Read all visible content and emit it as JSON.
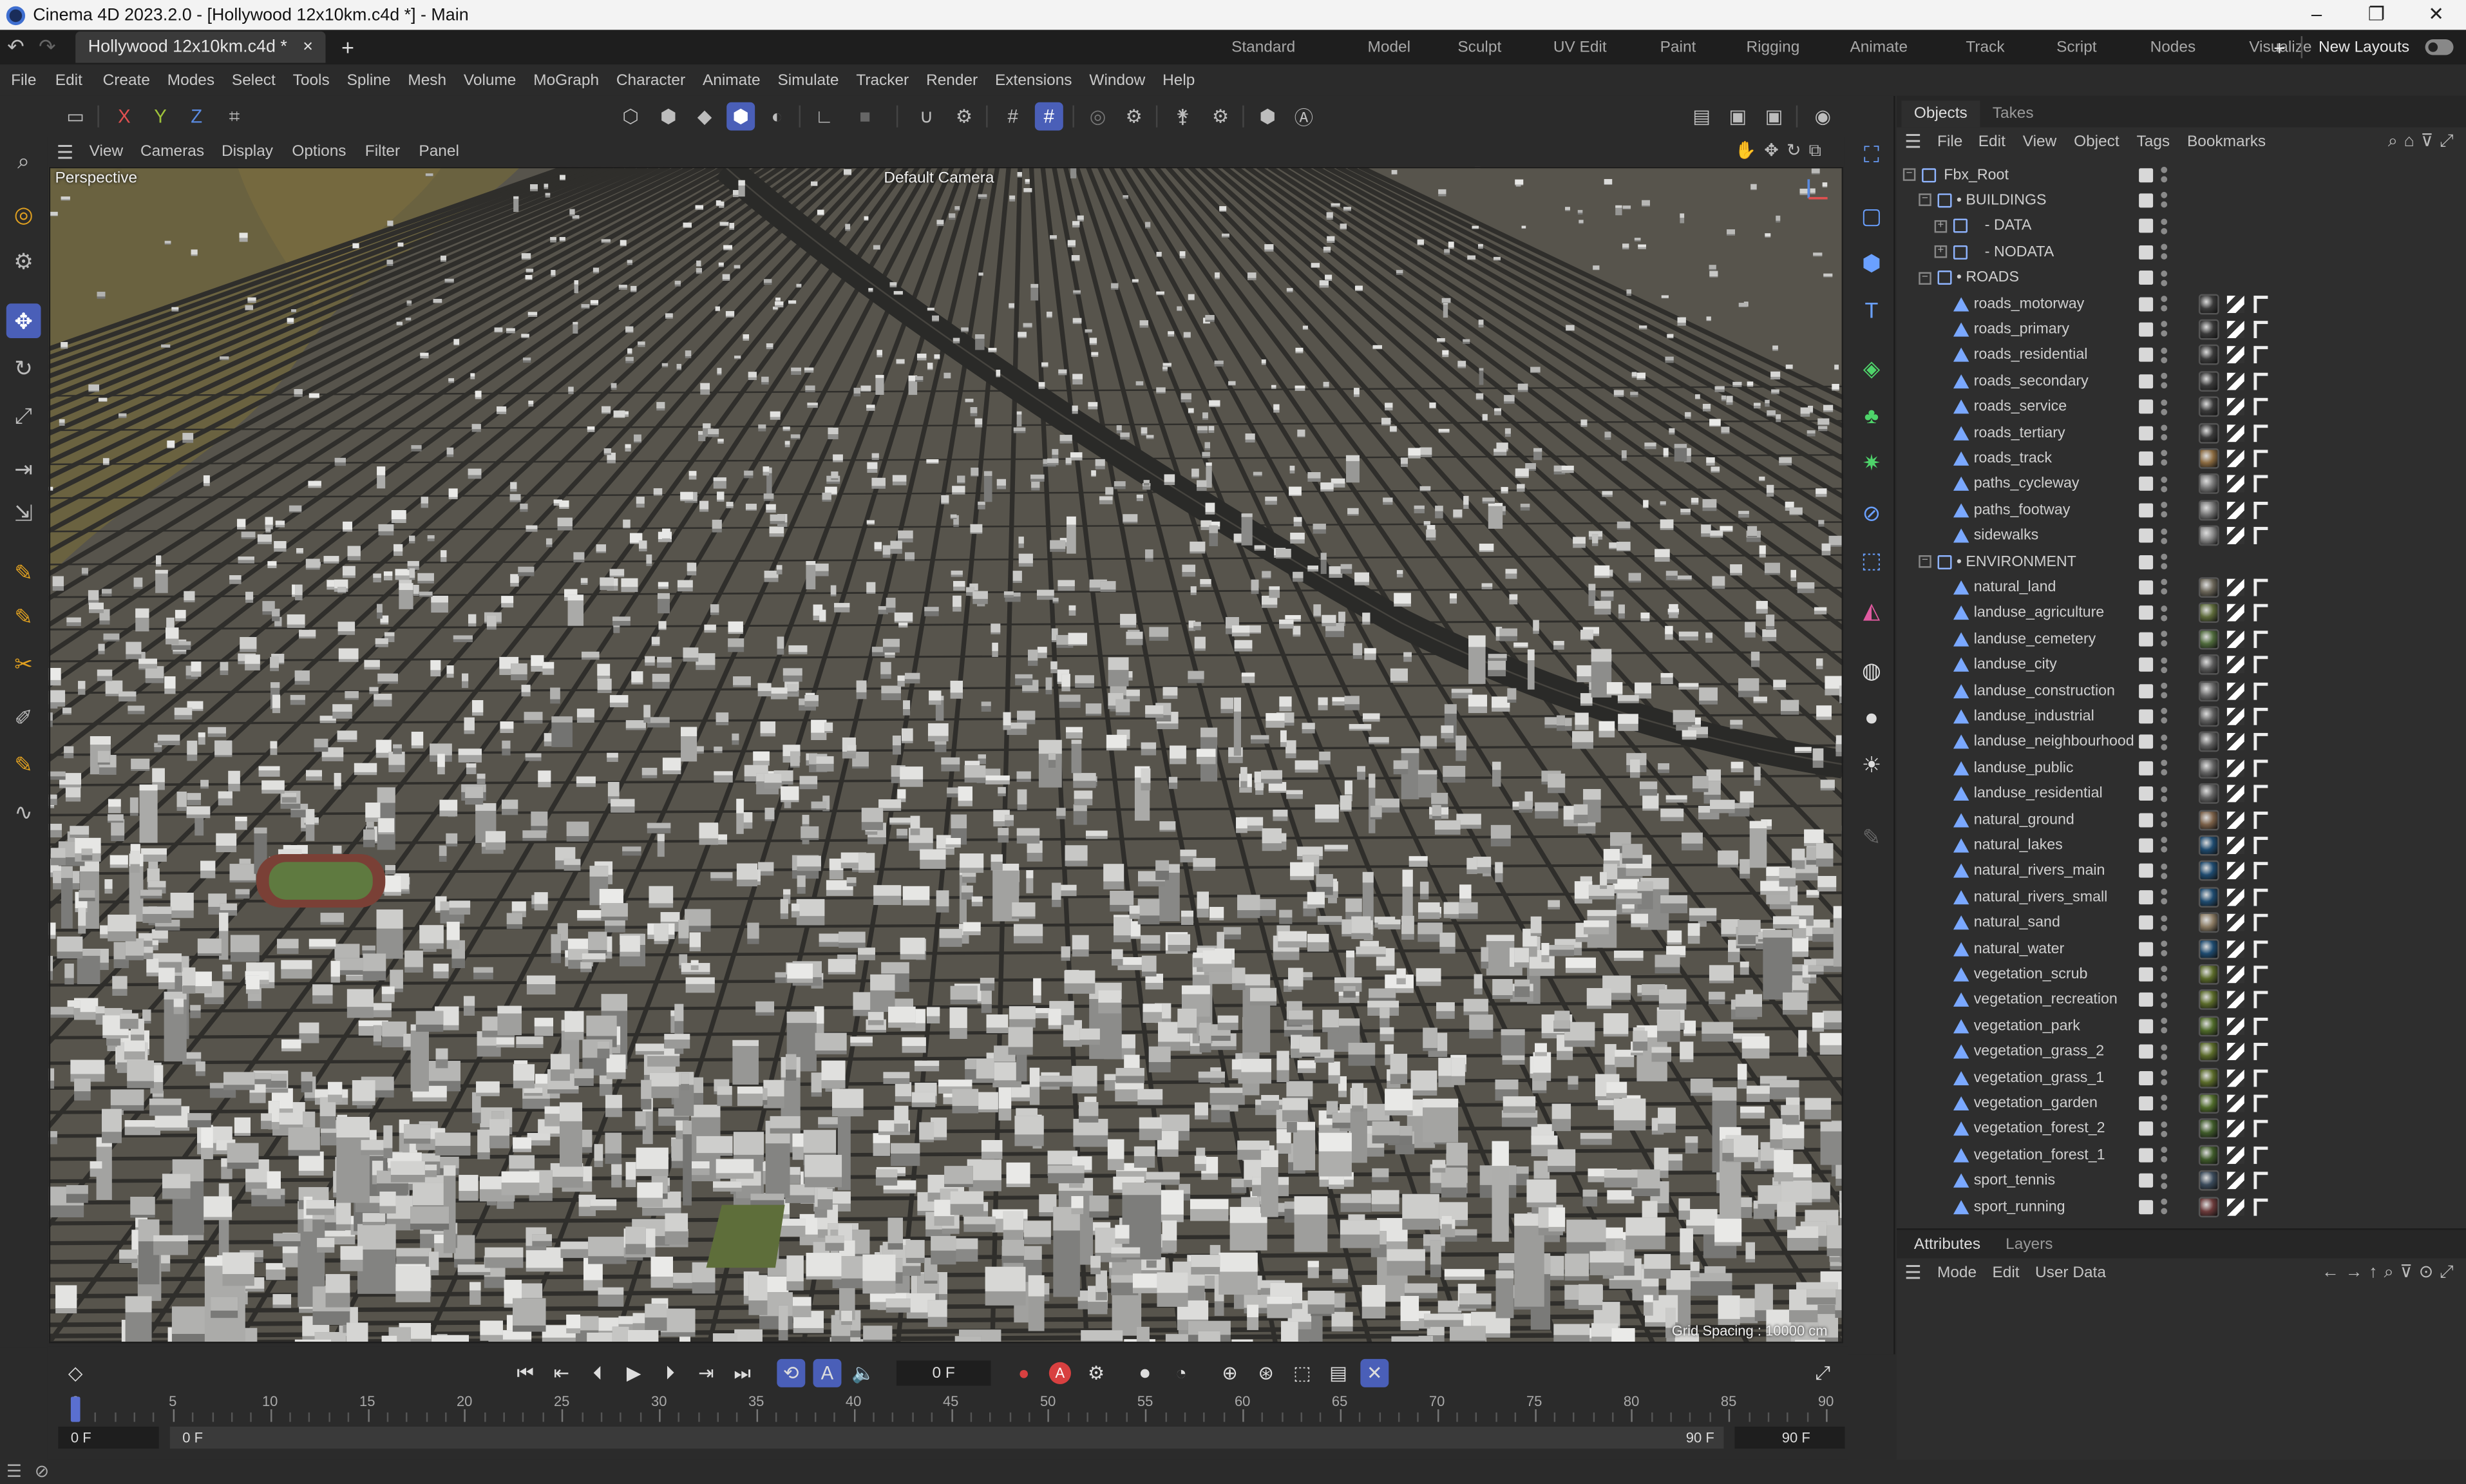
{
  "window": {
    "title": "Cinema 4D 2023.2.0 - [Hollywood 12x10km.c4d *] - Main",
    "controls": [
      "–",
      "❐",
      "✕"
    ]
  },
  "doc_tab": {
    "label": "Hollywood 12x10km.c4d *",
    "close": "×",
    "add": "+"
  },
  "layouts": [
    "Standard",
    "Model",
    "Sculpt",
    "UV Edit",
    "Paint",
    "Rigging",
    "Animate",
    "Track",
    "Script",
    "Nodes",
    "Visualize"
  ],
  "layouts_add": "+",
  "new_layouts": "New Layouts",
  "menu": [
    "File",
    "Edit",
    "Create",
    "Modes",
    "Select",
    "Tools",
    "Spline",
    "Mesh",
    "Volume",
    "MoGraph",
    "Character",
    "Animate",
    "Simulate",
    "Tracker",
    "Render",
    "Extensions",
    "Window",
    "Help"
  ],
  "axis_locks": {
    "x": "X",
    "y": "Y",
    "z": "Z"
  },
  "viewport_menu": [
    "View",
    "Cameras",
    "Display",
    "Options",
    "Filter",
    "Panel"
  ],
  "viewport": {
    "projection": "Perspective",
    "camera": "Default Camera",
    "camera_icon": "camera-icon",
    "grid_spacing": "Grid Spacing : 10000 cm"
  },
  "timeline": {
    "current_frame": "0 F",
    "ticks": [
      "0",
      "5",
      "10",
      "15",
      "20",
      "25",
      "30",
      "35",
      "40",
      "45",
      "50",
      "55",
      "60",
      "65",
      "70",
      "75",
      "80",
      "85",
      "90"
    ],
    "start_field": "0 F",
    "min_field": "0 F",
    "max_field": "90 F",
    "end_field": "90 F"
  },
  "objects_panel": {
    "tabs": [
      "Objects",
      "Takes"
    ],
    "menu": [
      "File",
      "Edit",
      "View",
      "Object",
      "Tags",
      "Bookmarks"
    ],
    "rows": [
      {
        "name": "Fbx_Root",
        "level": 0,
        "kind": "null",
        "expander": "−"
      },
      {
        "name": "• BUILDINGS",
        "level": 1,
        "kind": "null",
        "expander": "−"
      },
      {
        "name": "- DATA",
        "level": 2,
        "kind": "null",
        "expander": "+"
      },
      {
        "name": "- NODATA",
        "level": 2,
        "kind": "null",
        "expander": "+"
      },
      {
        "name": "• ROADS",
        "level": 1,
        "kind": "null",
        "expander": "−"
      },
      {
        "name": "roads_motorway",
        "level": 2,
        "kind": "poly",
        "mat": "#3a3a3a"
      },
      {
        "name": "roads_primary",
        "level": 2,
        "kind": "poly",
        "mat": "#3a3a3a"
      },
      {
        "name": "roads_residential",
        "level": 2,
        "kind": "poly",
        "mat": "#3a3a3a"
      },
      {
        "name": "roads_secondary",
        "level": 2,
        "kind": "poly",
        "mat": "#3a3a3a"
      },
      {
        "name": "roads_service",
        "level": 2,
        "kind": "poly",
        "mat": "#3a3a3a"
      },
      {
        "name": "roads_tertiary",
        "level": 2,
        "kind": "poly",
        "mat": "#3a3a3a"
      },
      {
        "name": "roads_track",
        "level": 2,
        "kind": "poly",
        "mat": "#8a6a40"
      },
      {
        "name": "paths_cycleway",
        "level": 2,
        "kind": "poly",
        "mat": "#777777"
      },
      {
        "name": "paths_footway",
        "level": 2,
        "kind": "poly",
        "mat": "#777777"
      },
      {
        "name": "sidewalks",
        "level": 2,
        "kind": "poly",
        "mat": "#888888"
      },
      {
        "name": "• ENVIRONMENT",
        "level": 1,
        "kind": "null",
        "expander": "−"
      },
      {
        "name": "natural_land",
        "level": 2,
        "kind": "poly",
        "mat": "#6a6558"
      },
      {
        "name": "landuse_agriculture",
        "level": 2,
        "kind": "poly",
        "mat": "#5d6a3a"
      },
      {
        "name": "landuse_cemetery",
        "level": 2,
        "kind": "poly",
        "mat": "#4f6a3c"
      },
      {
        "name": "landuse_city",
        "level": 2,
        "kind": "poly",
        "mat": "#5a5a5a"
      },
      {
        "name": "landuse_construction",
        "level": 2,
        "kind": "poly",
        "mat": "#6a6a6a"
      },
      {
        "name": "landuse_industrial",
        "level": 2,
        "kind": "poly",
        "mat": "#606060"
      },
      {
        "name": "landuse_neighbourhood",
        "level": 2,
        "kind": "poly",
        "mat": "#5f5f5f"
      },
      {
        "name": "landuse_public",
        "level": 2,
        "kind": "poly",
        "mat": "#646464"
      },
      {
        "name": "landuse_residential",
        "level": 2,
        "kind": "poly",
        "mat": "#636363"
      },
      {
        "name": "natural_ground",
        "level": 2,
        "kind": "poly",
        "mat": "#7a6048"
      },
      {
        "name": "natural_lakes",
        "level": 2,
        "kind": "poly",
        "mat": "#1e4a6e"
      },
      {
        "name": "natural_rivers_main",
        "level": 2,
        "kind": "poly",
        "mat": "#1e4a6e"
      },
      {
        "name": "natural_rivers_small",
        "level": 2,
        "kind": "poly",
        "mat": "#1e4a6e"
      },
      {
        "name": "natural_sand",
        "level": 2,
        "kind": "poly",
        "mat": "#8a7a62"
      },
      {
        "name": "natural_water",
        "level": 2,
        "kind": "poly",
        "mat": "#1e4a6e"
      },
      {
        "name": "vegetation_scrub",
        "level": 2,
        "kind": "poly",
        "mat": "#5a6a2a"
      },
      {
        "name": "vegetation_recreation",
        "level": 2,
        "kind": "poly",
        "mat": "#5a6a2a"
      },
      {
        "name": "vegetation_park",
        "level": 2,
        "kind": "poly",
        "mat": "#4f6a2a"
      },
      {
        "name": "vegetation_grass_2",
        "level": 2,
        "kind": "poly",
        "mat": "#5a6a2a"
      },
      {
        "name": "vegetation_grass_1",
        "level": 2,
        "kind": "poly",
        "mat": "#5a6a2a"
      },
      {
        "name": "vegetation_garden",
        "level": 2,
        "kind": "poly",
        "mat": "#4f6a2a"
      },
      {
        "name": "vegetation_forest_2",
        "level": 2,
        "kind": "poly",
        "mat": "#3f5a2a"
      },
      {
        "name": "vegetation_forest_1",
        "level": 2,
        "kind": "poly",
        "mat": "#3f5a2a"
      },
      {
        "name": "sport_tennis",
        "level": 2,
        "kind": "poly",
        "mat": "#3a4a5a"
      },
      {
        "name": "sport_running",
        "level": 2,
        "kind": "poly",
        "mat": "#6a3a3a"
      }
    ]
  },
  "attributes_panel": {
    "tabs": [
      "Attributes",
      "Layers"
    ],
    "menu": [
      "Mode",
      "Edit",
      "User Data"
    ]
  },
  "colors": {
    "accent": "#4a5fb8",
    "panel_bg": "#2b2b2b",
    "record_red": "#d84040"
  }
}
